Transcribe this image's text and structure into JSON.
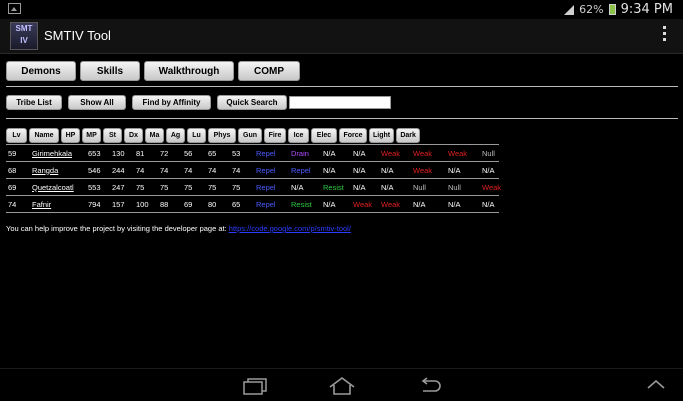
{
  "status": {
    "battery_pct": "62%",
    "time": "9:34 PM"
  },
  "app": {
    "title": "SMTIV Tool",
    "icon_text": "SMT IV"
  },
  "tabs": [
    "Demons",
    "Skills",
    "Walkthrough",
    "COMP"
  ],
  "toolbar": {
    "tribe_list": "Tribe List",
    "show_all": "Show All",
    "find_by_affinity": "Find by Affinity",
    "quick_search": "Quick Search",
    "quick_search_value": ""
  },
  "table": {
    "headers": [
      "Lv",
      "Name",
      "HP",
      "MP",
      "St",
      "Dx",
      "Ma",
      "Ag",
      "Lu",
      "Phys",
      "Gun",
      "Fire",
      "Ice",
      "Elec",
      "Force",
      "Light",
      "Dark"
    ],
    "rows": [
      [
        "59",
        "Girimehkala",
        "653",
        "130",
        "81",
        "72",
        "56",
        "65",
        "53",
        "Repel",
        "Drain",
        "N/A",
        "N/A",
        "Weak",
        "Weak",
        "Weak",
        "Null"
      ],
      [
        "68",
        "Rangda",
        "546",
        "244",
        "74",
        "74",
        "74",
        "74",
        "74",
        "Repel",
        "Repel",
        "N/A",
        "N/A",
        "N/A",
        "Weak",
        "N/A",
        "N/A"
      ],
      [
        "69",
        "Quetzalcoatl",
        "553",
        "247",
        "75",
        "75",
        "75",
        "75",
        "75",
        "Repel",
        "N/A",
        "Resist",
        "N/A",
        "N/A",
        "Null",
        "Null",
        "Weak"
      ],
      [
        "74",
        "Fafnir",
        "794",
        "157",
        "100",
        "88",
        "69",
        "80",
        "65",
        "Repel",
        "Resist",
        "N/A",
        "Weak",
        "Weak",
        "N/A",
        "N/A",
        "N/A"
      ]
    ]
  },
  "footer": {
    "text": "You can help improve the project by visiting the developer page at: ",
    "link": "https://code.google.com/p/smtiv-tool/"
  },
  "colors": {
    "repel": "#4a5cff",
    "drain": "#b24cff",
    "resist": "#2ecc40",
    "weak": "#e02020",
    "null": "#bdbdbd"
  },
  "nav": {
    "recent_icon": "recent-apps-icon",
    "home_icon": "home-icon",
    "back_icon": "back-icon",
    "up_icon": "chevron-up-icon"
  }
}
